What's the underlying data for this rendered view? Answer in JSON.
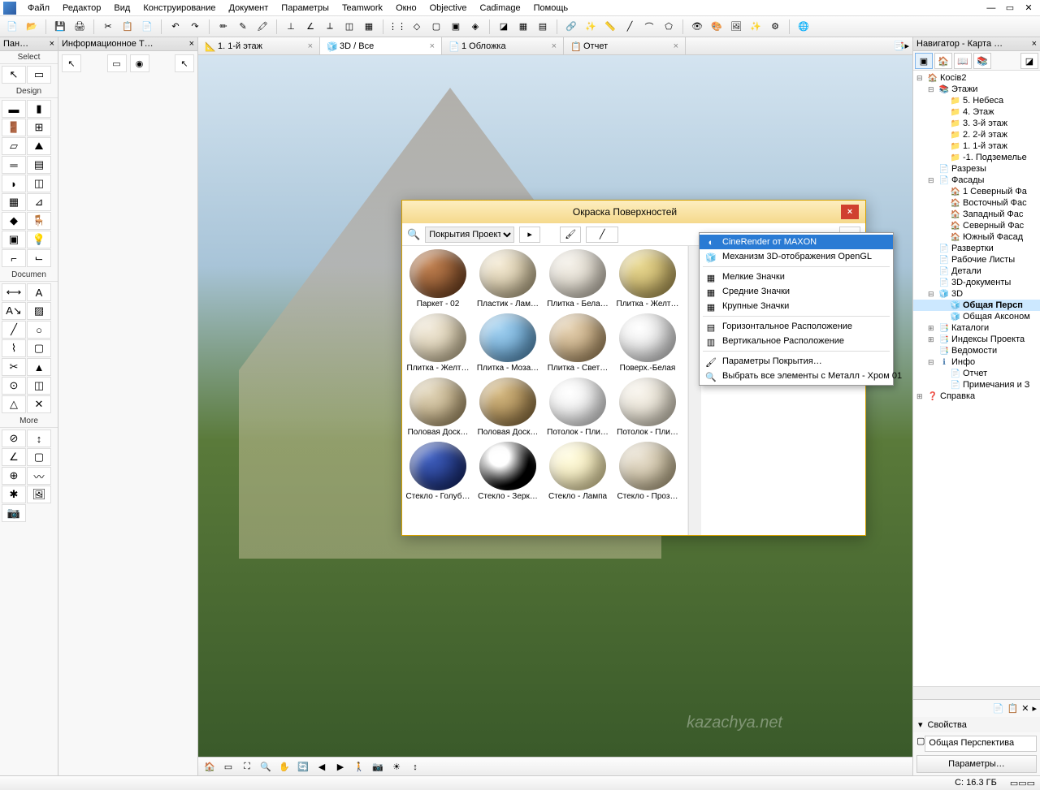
{
  "menu": {
    "items": [
      "Файл",
      "Редактор",
      "Вид",
      "Конструирование",
      "Документ",
      "Параметры",
      "Teamwork",
      "Окно",
      "Objective",
      "Cadimage",
      "Помощь"
    ]
  },
  "panels": {
    "toolbox_title": "Пан…",
    "info_title": "Информационное Т…",
    "navigator_title": "Навигатор - Карта …"
  },
  "toolbox_sections": [
    "Select",
    "Design",
    "Documen",
    "More"
  ],
  "tabs": [
    {
      "id": "floor",
      "label": "1. 1-й этаж",
      "icon": "📐"
    },
    {
      "id": "3d",
      "label": "3D / Все",
      "icon": "🧊",
      "active": true
    },
    {
      "id": "cover",
      "label": "1 Обложка",
      "icon": "📄"
    },
    {
      "id": "report",
      "label": "Отчет",
      "icon": "📋"
    }
  ],
  "navigator": {
    "root": "Косів2",
    "nodes": [
      {
        "l": 0,
        "exp": "⊟",
        "icon": "🏠",
        "label": "Косів2",
        "cls": "icon-folder"
      },
      {
        "l": 1,
        "exp": "⊟",
        "icon": "📚",
        "label": "Этажи",
        "cls": "icon-doc"
      },
      {
        "l": 2,
        "exp": "",
        "icon": "📁",
        "label": "5. Небеса",
        "cls": "icon-story"
      },
      {
        "l": 2,
        "exp": "",
        "icon": "📁",
        "label": "4. Этаж",
        "cls": "icon-story"
      },
      {
        "l": 2,
        "exp": "",
        "icon": "📁",
        "label": "3. 3-й этаж",
        "cls": "icon-story"
      },
      {
        "l": 2,
        "exp": "",
        "icon": "📁",
        "label": "2. 2-й этаж",
        "cls": "icon-story"
      },
      {
        "l": 2,
        "exp": "",
        "icon": "📁",
        "label": "1. 1-й этаж",
        "cls": "icon-story"
      },
      {
        "l": 2,
        "exp": "",
        "icon": "📁",
        "label": "-1. Подземелье",
        "cls": "icon-story"
      },
      {
        "l": 1,
        "exp": "",
        "icon": "📄",
        "label": "Разрезы",
        "cls": "icon-doc"
      },
      {
        "l": 1,
        "exp": "⊟",
        "icon": "📄",
        "label": "Фасады",
        "cls": "icon-doc"
      },
      {
        "l": 2,
        "exp": "",
        "icon": "🏠",
        "label": "1 Северный Фа",
        "cls": "icon-elev"
      },
      {
        "l": 2,
        "exp": "",
        "icon": "🏠",
        "label": "Восточный Фас",
        "cls": "icon-elev"
      },
      {
        "l": 2,
        "exp": "",
        "icon": "🏠",
        "label": "Западный Фас",
        "cls": "icon-elev"
      },
      {
        "l": 2,
        "exp": "",
        "icon": "🏠",
        "label": "Северный Фас",
        "cls": "icon-elev"
      },
      {
        "l": 2,
        "exp": "",
        "icon": "🏠",
        "label": "Южный Фасад",
        "cls": "icon-elev"
      },
      {
        "l": 1,
        "exp": "",
        "icon": "📄",
        "label": "Развертки",
        "cls": "icon-doc"
      },
      {
        "l": 1,
        "exp": "",
        "icon": "📄",
        "label": "Рабочие Листы",
        "cls": "icon-doc"
      },
      {
        "l": 1,
        "exp": "",
        "icon": "📄",
        "label": "Детали",
        "cls": "icon-doc"
      },
      {
        "l": 1,
        "exp": "",
        "icon": "📄",
        "label": "3D-документы",
        "cls": "icon-doc"
      },
      {
        "l": 1,
        "exp": "⊟",
        "icon": "🧊",
        "label": "3D",
        "cls": "icon-3d"
      },
      {
        "l": 2,
        "exp": "",
        "icon": "🧊",
        "label": "Общая Персп",
        "cls": "icon-3d",
        "sel": true
      },
      {
        "l": 2,
        "exp": "",
        "icon": "🧊",
        "label": "Общая Аксоном",
        "cls": "icon-3d"
      },
      {
        "l": 1,
        "exp": "⊞",
        "icon": "📑",
        "label": "Каталоги",
        "cls": "icon-doc"
      },
      {
        "l": 1,
        "exp": "⊞",
        "icon": "📑",
        "label": "Индексы Проекта",
        "cls": "icon-doc"
      },
      {
        "l": 1,
        "exp": "",
        "icon": "📑",
        "label": "Ведомости",
        "cls": "icon-doc"
      },
      {
        "l": 1,
        "exp": "⊟",
        "icon": "ℹ",
        "label": "Инфо",
        "cls": "icon-doc"
      },
      {
        "l": 2,
        "exp": "",
        "icon": "📄",
        "label": "Отчет",
        "cls": "icon-doc"
      },
      {
        "l": 2,
        "exp": "",
        "icon": "📄",
        "label": "Примечания и З",
        "cls": "icon-doc"
      },
      {
        "l": 0,
        "exp": "⊞",
        "icon": "❓",
        "label": "Справка",
        "cls": "icon-doc"
      }
    ],
    "props_header": "Свойства",
    "props_value": "Общая Перспектива",
    "params_btn": "Параметры…"
  },
  "dialog": {
    "title": "Окраска Поверхностей",
    "filter": "Покрытия Проекта",
    "materials": [
      {
        "label": "Паркет - 02",
        "bg": "radial-gradient(circle at 35% 30%, #c08050, #6a3a1a)"
      },
      {
        "label": "Пластик - Лам…",
        "bg": "radial-gradient(circle at 35% 30%, #f4ead4, #b8a880)"
      },
      {
        "label": "Плитка - Бела…",
        "bg": "radial-gradient(circle at 35% 30%, #f4f0e8, #c8c0b0)"
      },
      {
        "label": "Плитка - Желт…",
        "bg": "radial-gradient(circle at 35% 30%, #e8d890, #b09850)"
      },
      {
        "label": "Плитка - Желт…",
        "bg": "radial-gradient(circle at 35% 30%, #f0e8d8, #c8b890)"
      },
      {
        "label": "Плитка - Моза…",
        "bg": "radial-gradient(circle at 35% 30%, #a0d0f0, #5090c0)"
      },
      {
        "label": "Плитка - Свет…",
        "bg": "radial-gradient(circle at 35% 30%, #e4d0b0, #a88858)"
      },
      {
        "label": "Поверх.-Белая",
        "bg": "radial-gradient(circle at 35% 30%, #ffffff, #d0d0d0)"
      },
      {
        "label": "Половая Доск…",
        "bg": "radial-gradient(circle at 35% 30%, #e0d4b8, #a89060)"
      },
      {
        "label": "Половая Доск…",
        "bg": "radial-gradient(circle at 35% 30%, #d4b880, #8a6a38)"
      },
      {
        "label": "Потолок - Пли…",
        "bg": "radial-gradient(circle at 35% 30%, #ffffff, #dedede)"
      },
      {
        "label": "Потолок - Пли…",
        "bg": "radial-gradient(circle at 35% 30%, #f8f4ec, #d4ccb8)"
      },
      {
        "label": "Стекло - Голуб…",
        "bg": "radial-gradient(circle at 35% 30%, #4060c0, #102060)"
      },
      {
        "label": "Стекло - Зерк…",
        "bg": "radial-gradient(circle at 35% 30%, #ffffff 20%, #000000 60%)"
      },
      {
        "label": "Стекло - Лампа",
        "bg": "radial-gradient(circle at 35% 30%, #fffce0, #e8d89a)"
      },
      {
        "label": "Стекло - Проз…",
        "bg": "radial-gradient(circle at 35% 30%, #e8e0d0, #b8a880)"
      }
    ]
  },
  "context_menu": {
    "items": [
      {
        "label": "CineRender от MAXON",
        "highlighted": true,
        "icon": "◐"
      },
      {
        "label": "Механизм 3D-отображения OpenGL",
        "icon": "🧊"
      },
      {
        "sep": true
      },
      {
        "label": "Мелкие Значки",
        "icon": "▦"
      },
      {
        "label": "Средние Значки",
        "icon": "▦"
      },
      {
        "label": "Крупные Значки",
        "icon": "▦"
      },
      {
        "sep": true
      },
      {
        "label": "Горизонтальное Расположение",
        "icon": "▤"
      },
      {
        "label": "Вертикальное Расположение",
        "icon": "▥"
      },
      {
        "sep": true
      },
      {
        "label": "Параметры Покрытия…",
        "icon": "🖌"
      },
      {
        "label": "Выбрать все элементы с Металл - Хром 01",
        "icon": "🔍"
      }
    ]
  },
  "status": {
    "disk": "C: 16.3 ГБ",
    "mem": ""
  },
  "watermark": "kazachya.net"
}
